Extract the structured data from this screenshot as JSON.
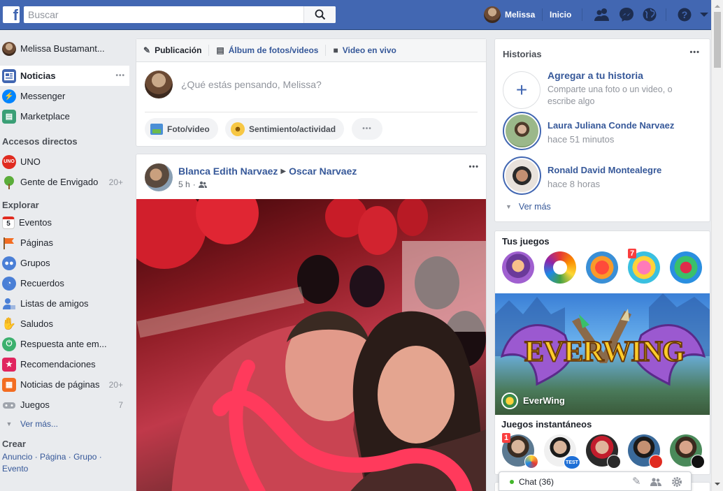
{
  "topbar": {
    "search_placeholder": "Buscar",
    "user_name": "Melissa",
    "home_label": "Inicio",
    "logo_letter": "f"
  },
  "leftnav": {
    "profile_name": "Melissa Bustamant...",
    "main_items": [
      {
        "label": "Noticias",
        "icon": "news-feed-icon",
        "more": "•••"
      },
      {
        "label": "Messenger",
        "icon": "messenger-icon"
      },
      {
        "label": "Marketplace",
        "icon": "marketplace-icon"
      }
    ],
    "shortcuts_heading": "Accesos directos",
    "shortcuts": [
      {
        "label": "UNO",
        "icon": "uno-game-icon"
      },
      {
        "label": "Gente de Envigado",
        "icon": "group-tree-icon",
        "count": "20+"
      }
    ],
    "explore_heading": "Explorar",
    "explore": [
      {
        "label": "Eventos",
        "icon": "calendar-icon",
        "glyph": "5"
      },
      {
        "label": "Páginas",
        "icon": "flag-icon"
      },
      {
        "label": "Grupos",
        "icon": "groups-icon"
      },
      {
        "label": "Recuerdos",
        "icon": "memories-clock-icon"
      },
      {
        "label": "Listas de amigos",
        "icon": "friend-list-icon"
      },
      {
        "label": "Saludos",
        "icon": "wave-hand-icon"
      },
      {
        "label": "Respuesta ante em...",
        "icon": "crisis-response-icon"
      },
      {
        "label": "Recomendaciones",
        "icon": "recommendations-icon"
      },
      {
        "label": "Noticias de páginas",
        "icon": "pages-feed-icon",
        "count": "20+"
      },
      {
        "label": "Juegos",
        "icon": "gamepad-icon",
        "count": "7"
      }
    ],
    "see_more": "Ver más...",
    "create_heading": "Crear",
    "create_links": [
      "Anuncio",
      "Página",
      "Grupo",
      "Evento"
    ]
  },
  "composer": {
    "tabs": [
      "Publicación",
      "Álbum de fotos/videos",
      "Video en vivo"
    ],
    "placeholder": "¿Qué estás pensando, Melissa?",
    "photo_button": "Foto/video",
    "feeling_button": "Sentimiento/actividad",
    "more_button": "•••"
  },
  "post": {
    "author": "Blanca Edith Narvaez",
    "target": "Oscar Narvaez",
    "time": "5 h",
    "dot": "·",
    "privacy_icon": "friends-icon",
    "menu": "•••"
  },
  "stories": {
    "title": "Historias",
    "menu": "•••",
    "add_title": "Agregar a tu historia",
    "add_sub": "Comparte una foto o un video, o escribe algo",
    "items": [
      {
        "name": "Laura Juliana Conde Narvaez",
        "time": "hace 51 minutos"
      },
      {
        "name": "Ronald David Montealegre",
        "time": "hace 8 horas"
      }
    ],
    "see_more": "Ver más"
  },
  "games": {
    "title": "Tus juegos",
    "badge": "7",
    "banner_name": "EverWing",
    "banner_logo": "EVERWING",
    "instant_title": "Juegos instantáneos",
    "instant_badge": "1",
    "instant_tags": [
      "TEST"
    ]
  },
  "chat": {
    "label": "Chat (36)"
  },
  "colors": {
    "brand": "#4267b2",
    "link": "#365899",
    "online": "#42b72a"
  }
}
